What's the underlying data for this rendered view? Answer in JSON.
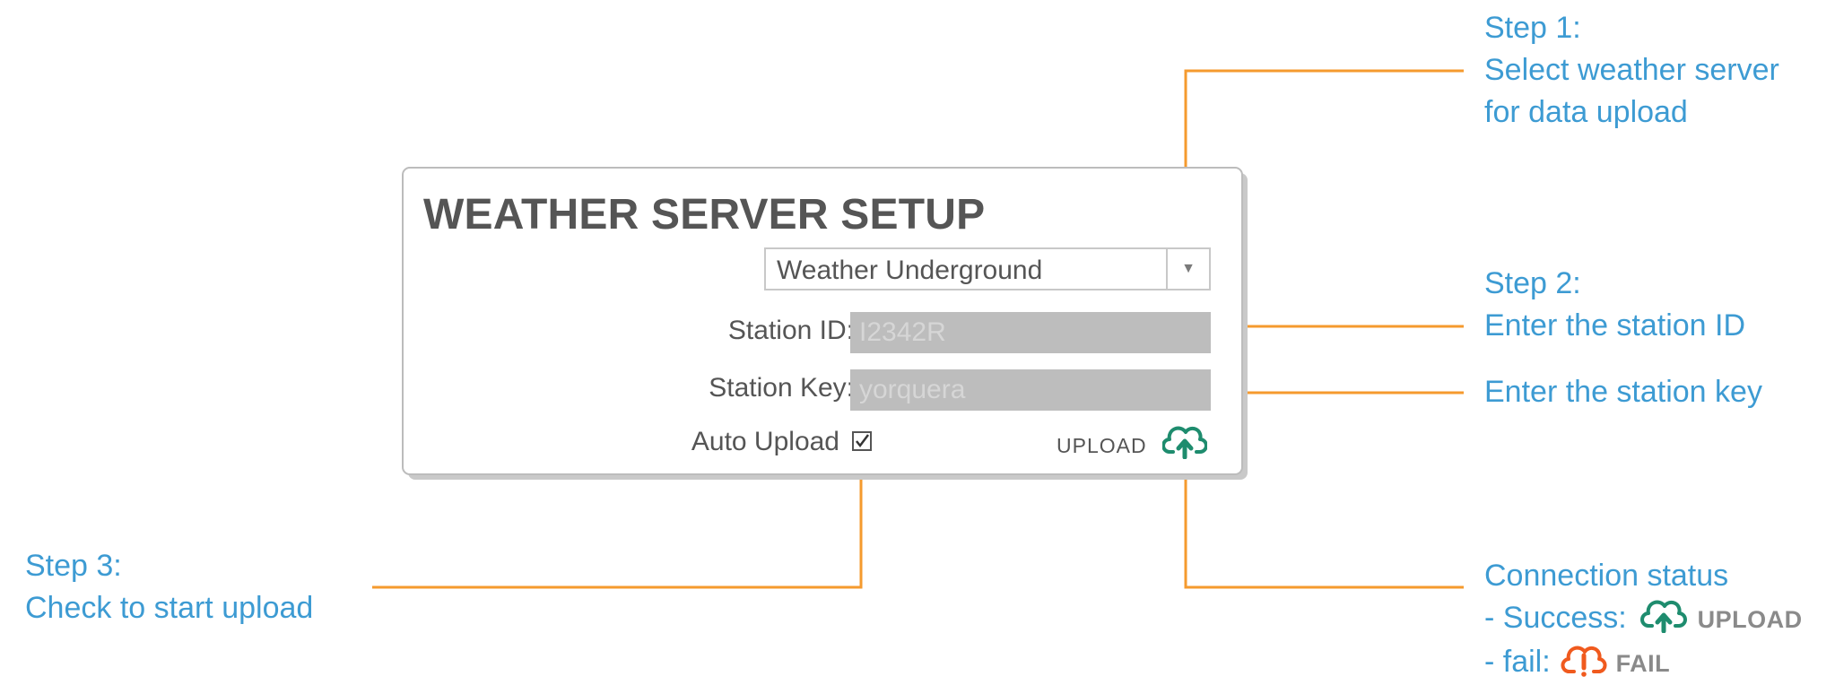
{
  "panel": {
    "title": "WEATHER SERVER SETUP",
    "server_select": {
      "value": "Weather Underground"
    },
    "station_id": {
      "label": "Station ID:",
      "value": "I2342R"
    },
    "station_key": {
      "label": "Station Key:",
      "value": "yorquera"
    },
    "auto_upload": {
      "label": "Auto Upload",
      "checked": true
    },
    "upload_status": {
      "label": "UPLOAD"
    }
  },
  "annotations": {
    "step1": {
      "line1": "Step 1:",
      "line2": "Select weather server",
      "line3": "for data upload"
    },
    "step2": {
      "line1": "Step 2:",
      "line2": "Enter the station ID"
    },
    "step2b": {
      "line1": "Enter the station key"
    },
    "step3": {
      "line1": "Step 3:",
      "line2": "Check to start upload"
    },
    "status": {
      "title": "Connection status",
      "success_prefix": "- Success:",
      "success_word": "UPLOAD",
      "fail_prefix": "- fail:",
      "fail_word": "FAIL"
    }
  },
  "colors": {
    "annotation_text": "#3d9bd3",
    "leader_line": "#f59a2e",
    "success_icon": "#1e8c6e",
    "fail_icon": "#f05a1e"
  },
  "icons": {
    "select_arrow": "triangle-down-icon",
    "upload_success": "cloud-upload-icon",
    "upload_fail": "cloud-alert-icon",
    "checkbox": "checkmark-icon"
  }
}
